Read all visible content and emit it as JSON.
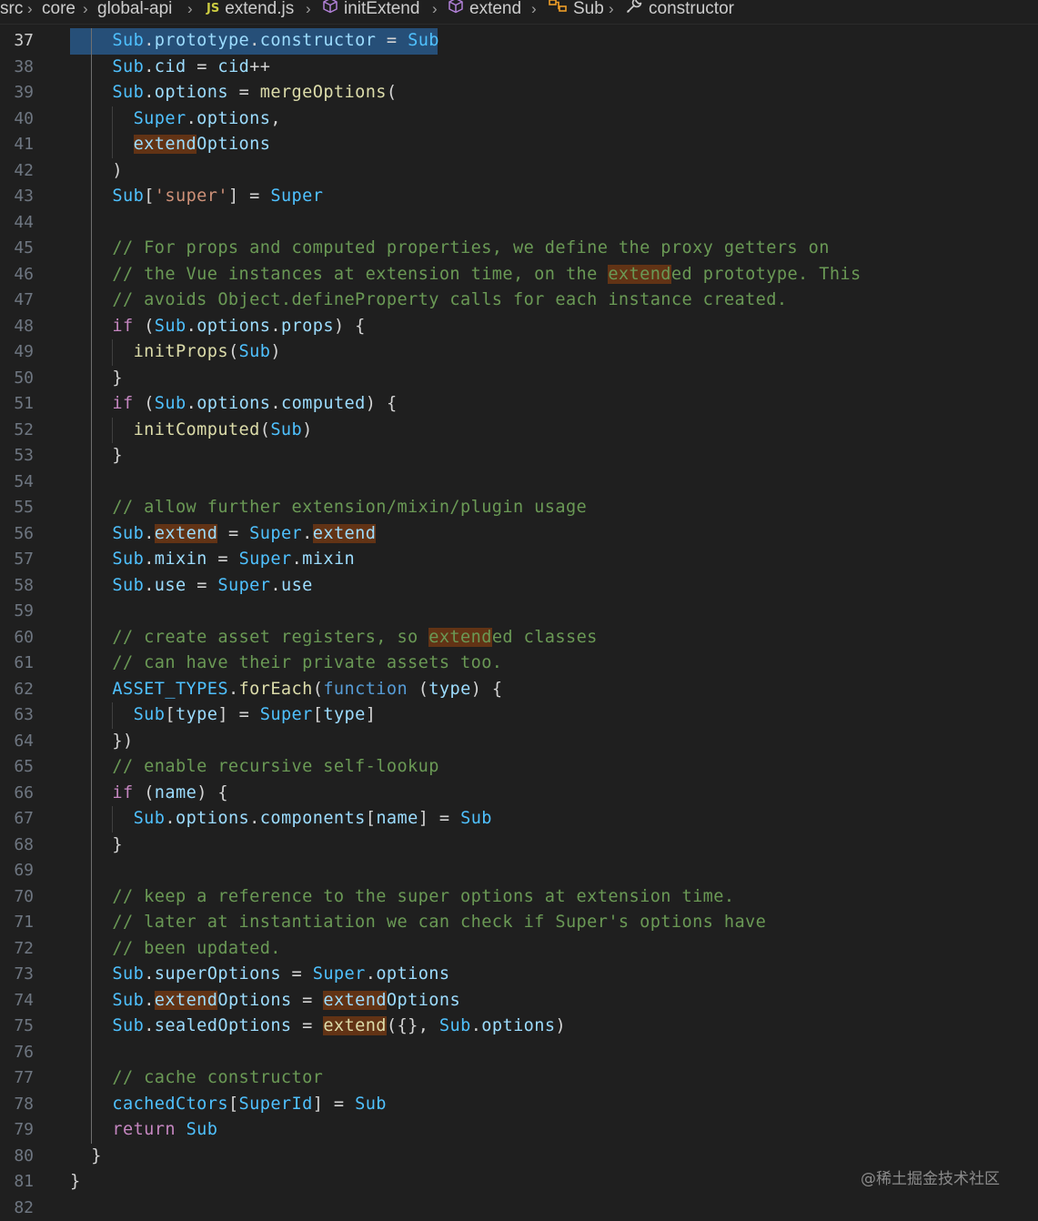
{
  "breadcrumb": {
    "items": [
      {
        "label": "src",
        "icon": ""
      },
      {
        "label": "core",
        "icon": ""
      },
      {
        "label": "global-api",
        "icon": ""
      },
      {
        "label": "extend.js",
        "icon": "js-file-icon",
        "icon_text": "JS"
      },
      {
        "label": "initExtend",
        "icon": "cube-icon"
      },
      {
        "label": "extend",
        "icon": "cube-icon"
      },
      {
        "label": "Sub",
        "icon": "property-icon"
      },
      {
        "label": "constructor",
        "icon": "wrench-icon"
      }
    ],
    "separator": "›"
  },
  "editor": {
    "current_line": 37,
    "lines": [
      {
        "n": "37",
        "tokens": [
          {
            "t": "    ",
            "c": "ws"
          },
          {
            "t": "Sub",
            "c": "v"
          },
          {
            "t": ".",
            "c": "d"
          },
          {
            "t": "prototype",
            "c": "p"
          },
          {
            "t": ".",
            "c": "d"
          },
          {
            "t": "constructor",
            "c": "p"
          },
          {
            "t": " = ",
            "c": "d"
          },
          {
            "t": "Sub",
            "c": "v"
          }
        ]
      },
      {
        "n": "38",
        "tokens": [
          {
            "t": "    ",
            "c": "d"
          },
          {
            "t": "Sub",
            "c": "v"
          },
          {
            "t": ".",
            "c": "d"
          },
          {
            "t": "cid",
            "c": "p"
          },
          {
            "t": " = ",
            "c": "d"
          },
          {
            "t": "cid",
            "c": "p"
          },
          {
            "t": "++",
            "c": "d"
          }
        ]
      },
      {
        "n": "39",
        "tokens": [
          {
            "t": "    ",
            "c": "d"
          },
          {
            "t": "Sub",
            "c": "v"
          },
          {
            "t": ".",
            "c": "d"
          },
          {
            "t": "options",
            "c": "p"
          },
          {
            "t": " = ",
            "c": "d"
          },
          {
            "t": "mergeOptions",
            "c": "f"
          },
          {
            "t": "(",
            "c": "d"
          }
        ]
      },
      {
        "n": "40",
        "tokens": [
          {
            "t": "      ",
            "c": "d"
          },
          {
            "t": "Super",
            "c": "v"
          },
          {
            "t": ".",
            "c": "d"
          },
          {
            "t": "options",
            "c": "p"
          },
          {
            "t": ",",
            "c": "d"
          }
        ]
      },
      {
        "n": "41",
        "tokens": [
          {
            "t": "      ",
            "c": "d"
          },
          {
            "t": "extend",
            "c": "p",
            "hl": true
          },
          {
            "t": "Options",
            "c": "p"
          }
        ]
      },
      {
        "n": "42",
        "tokens": [
          {
            "t": "    ",
            "c": "d"
          },
          {
            "t": ")",
            "c": "d"
          }
        ]
      },
      {
        "n": "43",
        "tokens": [
          {
            "t": "    ",
            "c": "d"
          },
          {
            "t": "Sub",
            "c": "v"
          },
          {
            "t": "[",
            "c": "d"
          },
          {
            "t": "'super'",
            "c": "s"
          },
          {
            "t": "] = ",
            "c": "d"
          },
          {
            "t": "Super",
            "c": "v"
          }
        ]
      },
      {
        "n": "44",
        "tokens": []
      },
      {
        "n": "45",
        "tokens": [
          {
            "t": "    ",
            "c": "d"
          },
          {
            "t": "// For props and computed properties, we define the proxy getters on",
            "c": "c"
          }
        ]
      },
      {
        "n": "46",
        "tokens": [
          {
            "t": "    ",
            "c": "d"
          },
          {
            "t": "// the Vue instances at extension time, on the ",
            "c": "c"
          },
          {
            "t": "extend",
            "c": "c",
            "hl": true
          },
          {
            "t": "ed prototype. This",
            "c": "c"
          }
        ]
      },
      {
        "n": "47",
        "tokens": [
          {
            "t": "    ",
            "c": "d"
          },
          {
            "t": "// avoids Object.defineProperty calls for each instance created.",
            "c": "c"
          }
        ]
      },
      {
        "n": "48",
        "tokens": [
          {
            "t": "    ",
            "c": "d"
          },
          {
            "t": "if",
            "c": "k"
          },
          {
            "t": " (",
            "c": "d"
          },
          {
            "t": "Sub",
            "c": "v"
          },
          {
            "t": ".",
            "c": "d"
          },
          {
            "t": "options",
            "c": "p"
          },
          {
            "t": ".",
            "c": "d"
          },
          {
            "t": "props",
            "c": "p"
          },
          {
            "t": ") {",
            "c": "d"
          }
        ]
      },
      {
        "n": "49",
        "tokens": [
          {
            "t": "      ",
            "c": "d"
          },
          {
            "t": "initProps",
            "c": "f"
          },
          {
            "t": "(",
            "c": "d"
          },
          {
            "t": "Sub",
            "c": "v"
          },
          {
            "t": ")",
            "c": "d"
          }
        ]
      },
      {
        "n": "50",
        "tokens": [
          {
            "t": "    ",
            "c": "d"
          },
          {
            "t": "}",
            "c": "d"
          }
        ]
      },
      {
        "n": "51",
        "tokens": [
          {
            "t": "    ",
            "c": "d"
          },
          {
            "t": "if",
            "c": "k"
          },
          {
            "t": " (",
            "c": "d"
          },
          {
            "t": "Sub",
            "c": "v"
          },
          {
            "t": ".",
            "c": "d"
          },
          {
            "t": "options",
            "c": "p"
          },
          {
            "t": ".",
            "c": "d"
          },
          {
            "t": "computed",
            "c": "p"
          },
          {
            "t": ") {",
            "c": "d"
          }
        ]
      },
      {
        "n": "52",
        "tokens": [
          {
            "t": "      ",
            "c": "d"
          },
          {
            "t": "initComputed",
            "c": "f"
          },
          {
            "t": "(",
            "c": "d"
          },
          {
            "t": "Sub",
            "c": "v"
          },
          {
            "t": ")",
            "c": "d"
          }
        ]
      },
      {
        "n": "53",
        "tokens": [
          {
            "t": "    ",
            "c": "d"
          },
          {
            "t": "}",
            "c": "d"
          }
        ]
      },
      {
        "n": "54",
        "tokens": []
      },
      {
        "n": "55",
        "tokens": [
          {
            "t": "    ",
            "c": "d"
          },
          {
            "t": "// allow further extension/mixin/plugin usage",
            "c": "c"
          }
        ]
      },
      {
        "n": "56",
        "tokens": [
          {
            "t": "    ",
            "c": "d"
          },
          {
            "t": "Sub",
            "c": "v"
          },
          {
            "t": ".",
            "c": "d"
          },
          {
            "t": "extend",
            "c": "p",
            "hl": true
          },
          {
            "t": " = ",
            "c": "d"
          },
          {
            "t": "Super",
            "c": "v"
          },
          {
            "t": ".",
            "c": "d"
          },
          {
            "t": "extend",
            "c": "p",
            "hl": true
          }
        ]
      },
      {
        "n": "57",
        "tokens": [
          {
            "t": "    ",
            "c": "d"
          },
          {
            "t": "Sub",
            "c": "v"
          },
          {
            "t": ".",
            "c": "d"
          },
          {
            "t": "mixin",
            "c": "p"
          },
          {
            "t": " = ",
            "c": "d"
          },
          {
            "t": "Super",
            "c": "v"
          },
          {
            "t": ".",
            "c": "d"
          },
          {
            "t": "mixin",
            "c": "p"
          }
        ]
      },
      {
        "n": "58",
        "tokens": [
          {
            "t": "    ",
            "c": "d"
          },
          {
            "t": "Sub",
            "c": "v"
          },
          {
            "t": ".",
            "c": "d"
          },
          {
            "t": "use",
            "c": "p"
          },
          {
            "t": " = ",
            "c": "d"
          },
          {
            "t": "Super",
            "c": "v"
          },
          {
            "t": ".",
            "c": "d"
          },
          {
            "t": "use",
            "c": "p"
          }
        ]
      },
      {
        "n": "59",
        "tokens": []
      },
      {
        "n": "60",
        "tokens": [
          {
            "t": "    ",
            "c": "d"
          },
          {
            "t": "// create asset registers, so ",
            "c": "c"
          },
          {
            "t": "extend",
            "c": "c",
            "hl": true
          },
          {
            "t": "ed classes",
            "c": "c"
          }
        ]
      },
      {
        "n": "61",
        "tokens": [
          {
            "t": "    ",
            "c": "d"
          },
          {
            "t": "// can have their private assets too.",
            "c": "c"
          }
        ]
      },
      {
        "n": "62",
        "tokens": [
          {
            "t": "    ",
            "c": "d"
          },
          {
            "t": "ASSET_TYPES",
            "c": "v"
          },
          {
            "t": ".",
            "c": "d"
          },
          {
            "t": "forEach",
            "c": "f"
          },
          {
            "t": "(",
            "c": "d"
          },
          {
            "t": "function",
            "c": "kw"
          },
          {
            "t": " (",
            "c": "d"
          },
          {
            "t": "type",
            "c": "p"
          },
          {
            "t": ") {",
            "c": "d"
          }
        ]
      },
      {
        "n": "63",
        "tokens": [
          {
            "t": "      ",
            "c": "d"
          },
          {
            "t": "Sub",
            "c": "v"
          },
          {
            "t": "[",
            "c": "d"
          },
          {
            "t": "type",
            "c": "p"
          },
          {
            "t": "] = ",
            "c": "d"
          },
          {
            "t": "Super",
            "c": "v"
          },
          {
            "t": "[",
            "c": "d"
          },
          {
            "t": "type",
            "c": "p"
          },
          {
            "t": "]",
            "c": "d"
          }
        ]
      },
      {
        "n": "64",
        "tokens": [
          {
            "t": "    ",
            "c": "d"
          },
          {
            "t": "})",
            "c": "d"
          }
        ]
      },
      {
        "n": "65",
        "tokens": [
          {
            "t": "    ",
            "c": "d"
          },
          {
            "t": "// enable recursive self-lookup",
            "c": "c"
          }
        ]
      },
      {
        "n": "66",
        "tokens": [
          {
            "t": "    ",
            "c": "d"
          },
          {
            "t": "if",
            "c": "k"
          },
          {
            "t": " (",
            "c": "d"
          },
          {
            "t": "name",
            "c": "p"
          },
          {
            "t": ") {",
            "c": "d"
          }
        ]
      },
      {
        "n": "67",
        "tokens": [
          {
            "t": "      ",
            "c": "d"
          },
          {
            "t": "Sub",
            "c": "v"
          },
          {
            "t": ".",
            "c": "d"
          },
          {
            "t": "options",
            "c": "p"
          },
          {
            "t": ".",
            "c": "d"
          },
          {
            "t": "components",
            "c": "p"
          },
          {
            "t": "[",
            "c": "d"
          },
          {
            "t": "name",
            "c": "p"
          },
          {
            "t": "] = ",
            "c": "d"
          },
          {
            "t": "Sub",
            "c": "v"
          }
        ]
      },
      {
        "n": "68",
        "tokens": [
          {
            "t": "    ",
            "c": "d"
          },
          {
            "t": "}",
            "c": "d"
          }
        ]
      },
      {
        "n": "69",
        "tokens": []
      },
      {
        "n": "70",
        "tokens": [
          {
            "t": "    ",
            "c": "d"
          },
          {
            "t": "// keep a reference to the super options at extension time.",
            "c": "c"
          }
        ]
      },
      {
        "n": "71",
        "tokens": [
          {
            "t": "    ",
            "c": "d"
          },
          {
            "t": "// later at instantiation we can check if Super's options have",
            "c": "c"
          }
        ]
      },
      {
        "n": "72",
        "tokens": [
          {
            "t": "    ",
            "c": "d"
          },
          {
            "t": "// been updated.",
            "c": "c"
          }
        ]
      },
      {
        "n": "73",
        "tokens": [
          {
            "t": "    ",
            "c": "d"
          },
          {
            "t": "Sub",
            "c": "v"
          },
          {
            "t": ".",
            "c": "d"
          },
          {
            "t": "superOptions",
            "c": "p"
          },
          {
            "t": " = ",
            "c": "d"
          },
          {
            "t": "Super",
            "c": "v"
          },
          {
            "t": ".",
            "c": "d"
          },
          {
            "t": "options",
            "c": "p"
          }
        ]
      },
      {
        "n": "74",
        "tokens": [
          {
            "t": "    ",
            "c": "d"
          },
          {
            "t": "Sub",
            "c": "v"
          },
          {
            "t": ".",
            "c": "d"
          },
          {
            "t": "extend",
            "c": "p",
            "hl": true
          },
          {
            "t": "Options",
            "c": "p"
          },
          {
            "t": " = ",
            "c": "d"
          },
          {
            "t": "extend",
            "c": "p",
            "hl": true
          },
          {
            "t": "Options",
            "c": "p"
          }
        ]
      },
      {
        "n": "75",
        "tokens": [
          {
            "t": "    ",
            "c": "d"
          },
          {
            "t": "Sub",
            "c": "v"
          },
          {
            "t": ".",
            "c": "d"
          },
          {
            "t": "sealedOptions",
            "c": "p"
          },
          {
            "t": " = ",
            "c": "d"
          },
          {
            "t": "extend",
            "c": "f",
            "hl": true
          },
          {
            "t": "({}, ",
            "c": "d"
          },
          {
            "t": "Sub",
            "c": "v"
          },
          {
            "t": ".",
            "c": "d"
          },
          {
            "t": "options",
            "c": "p"
          },
          {
            "t": ")",
            "c": "d"
          }
        ]
      },
      {
        "n": "76",
        "tokens": []
      },
      {
        "n": "77",
        "tokens": [
          {
            "t": "    ",
            "c": "d"
          },
          {
            "t": "// cache constructor",
            "c": "c"
          }
        ]
      },
      {
        "n": "78",
        "tokens": [
          {
            "t": "    ",
            "c": "d"
          },
          {
            "t": "cachedCtors",
            "c": "v"
          },
          {
            "t": "[",
            "c": "d"
          },
          {
            "t": "SuperId",
            "c": "v"
          },
          {
            "t": "] = ",
            "c": "d"
          },
          {
            "t": "Sub",
            "c": "v"
          }
        ]
      },
      {
        "n": "79",
        "tokens": [
          {
            "t": "    ",
            "c": "d"
          },
          {
            "t": "return",
            "c": "k"
          },
          {
            "t": " ",
            "c": "d"
          },
          {
            "t": "Sub",
            "c": "v"
          }
        ]
      },
      {
        "n": "80",
        "tokens": [
          {
            "t": "  ",
            "c": "d"
          },
          {
            "t": "}",
            "c": "d"
          }
        ]
      },
      {
        "n": "81",
        "tokens": [
          {
            "t": "}",
            "c": "d"
          }
        ]
      },
      {
        "n": "82",
        "tokens": []
      }
    ]
  },
  "watermark": "@稀土掘金技术社区",
  "colors": {
    "background": "#1f1f1f",
    "selection": "#264f78",
    "find_highlight": "#623315",
    "comment": "#6a9955",
    "variable": "#4fc1ff",
    "property": "#9cdcfe",
    "function": "#dcdcaa",
    "keyword": "#c586c0",
    "string": "#ce9178"
  }
}
